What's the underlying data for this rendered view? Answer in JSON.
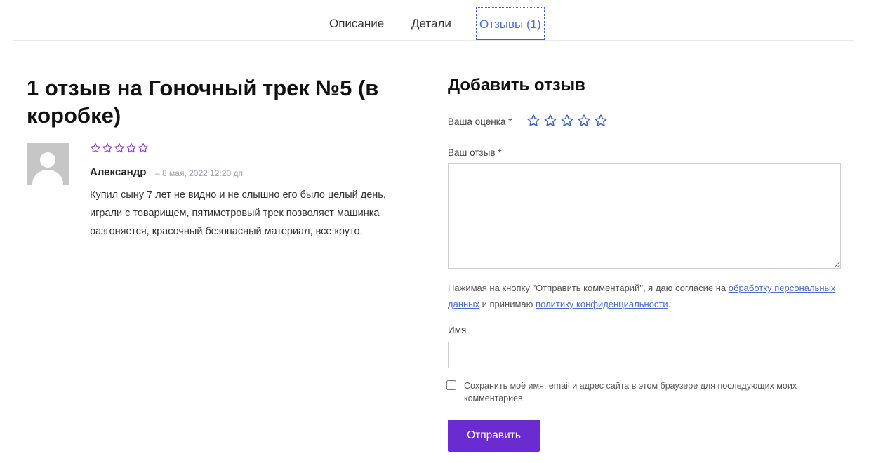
{
  "colors": {
    "accent": "#6a2bd0",
    "link": "#4a6cd4",
    "star_review": "#8a3fd8",
    "star_rating": "#3a5fd0"
  },
  "tabs": [
    {
      "label": "Описание",
      "active": false
    },
    {
      "label": "Детали",
      "active": false
    },
    {
      "label": "Отзывы (1)",
      "active": true
    }
  ],
  "reviews": {
    "title": "1 отзыв на Гоночный трек №5 (в коробке)",
    "items": [
      {
        "avatar_icon": "user-placeholder-icon",
        "stars": 5,
        "rating": 0,
        "author": "Александр",
        "date": "– 8 мая, 2022 12:20 дп",
        "text": "Купил сыну 7 лет не видно и не слышно его было целый день, играли с товарищем, пятиметровый трек позволяет машинка разгоняется, красочный безопасный материал, все круто."
      }
    ]
  },
  "form": {
    "title": "Добавить отзыв",
    "rating_label": "Ваша оценка *",
    "rating_stars": 5,
    "review_label": "Ваш отзыв *",
    "review_value": "",
    "consent_prefix": "Нажимая на кнопку \"Отправить комментарий\", я даю согласие на ",
    "consent_link1": "обработку персональных данных",
    "consent_middle": " и принимаю ",
    "consent_link2": "политику конфиденциальности",
    "consent_suffix": ".",
    "name_label": "Имя",
    "name_value": "",
    "save_label": "Сохранить моё имя, email и адрес сайта в этом браузере для последующих моих комментариев.",
    "save_checked": false,
    "submit_label": "Отправить"
  }
}
